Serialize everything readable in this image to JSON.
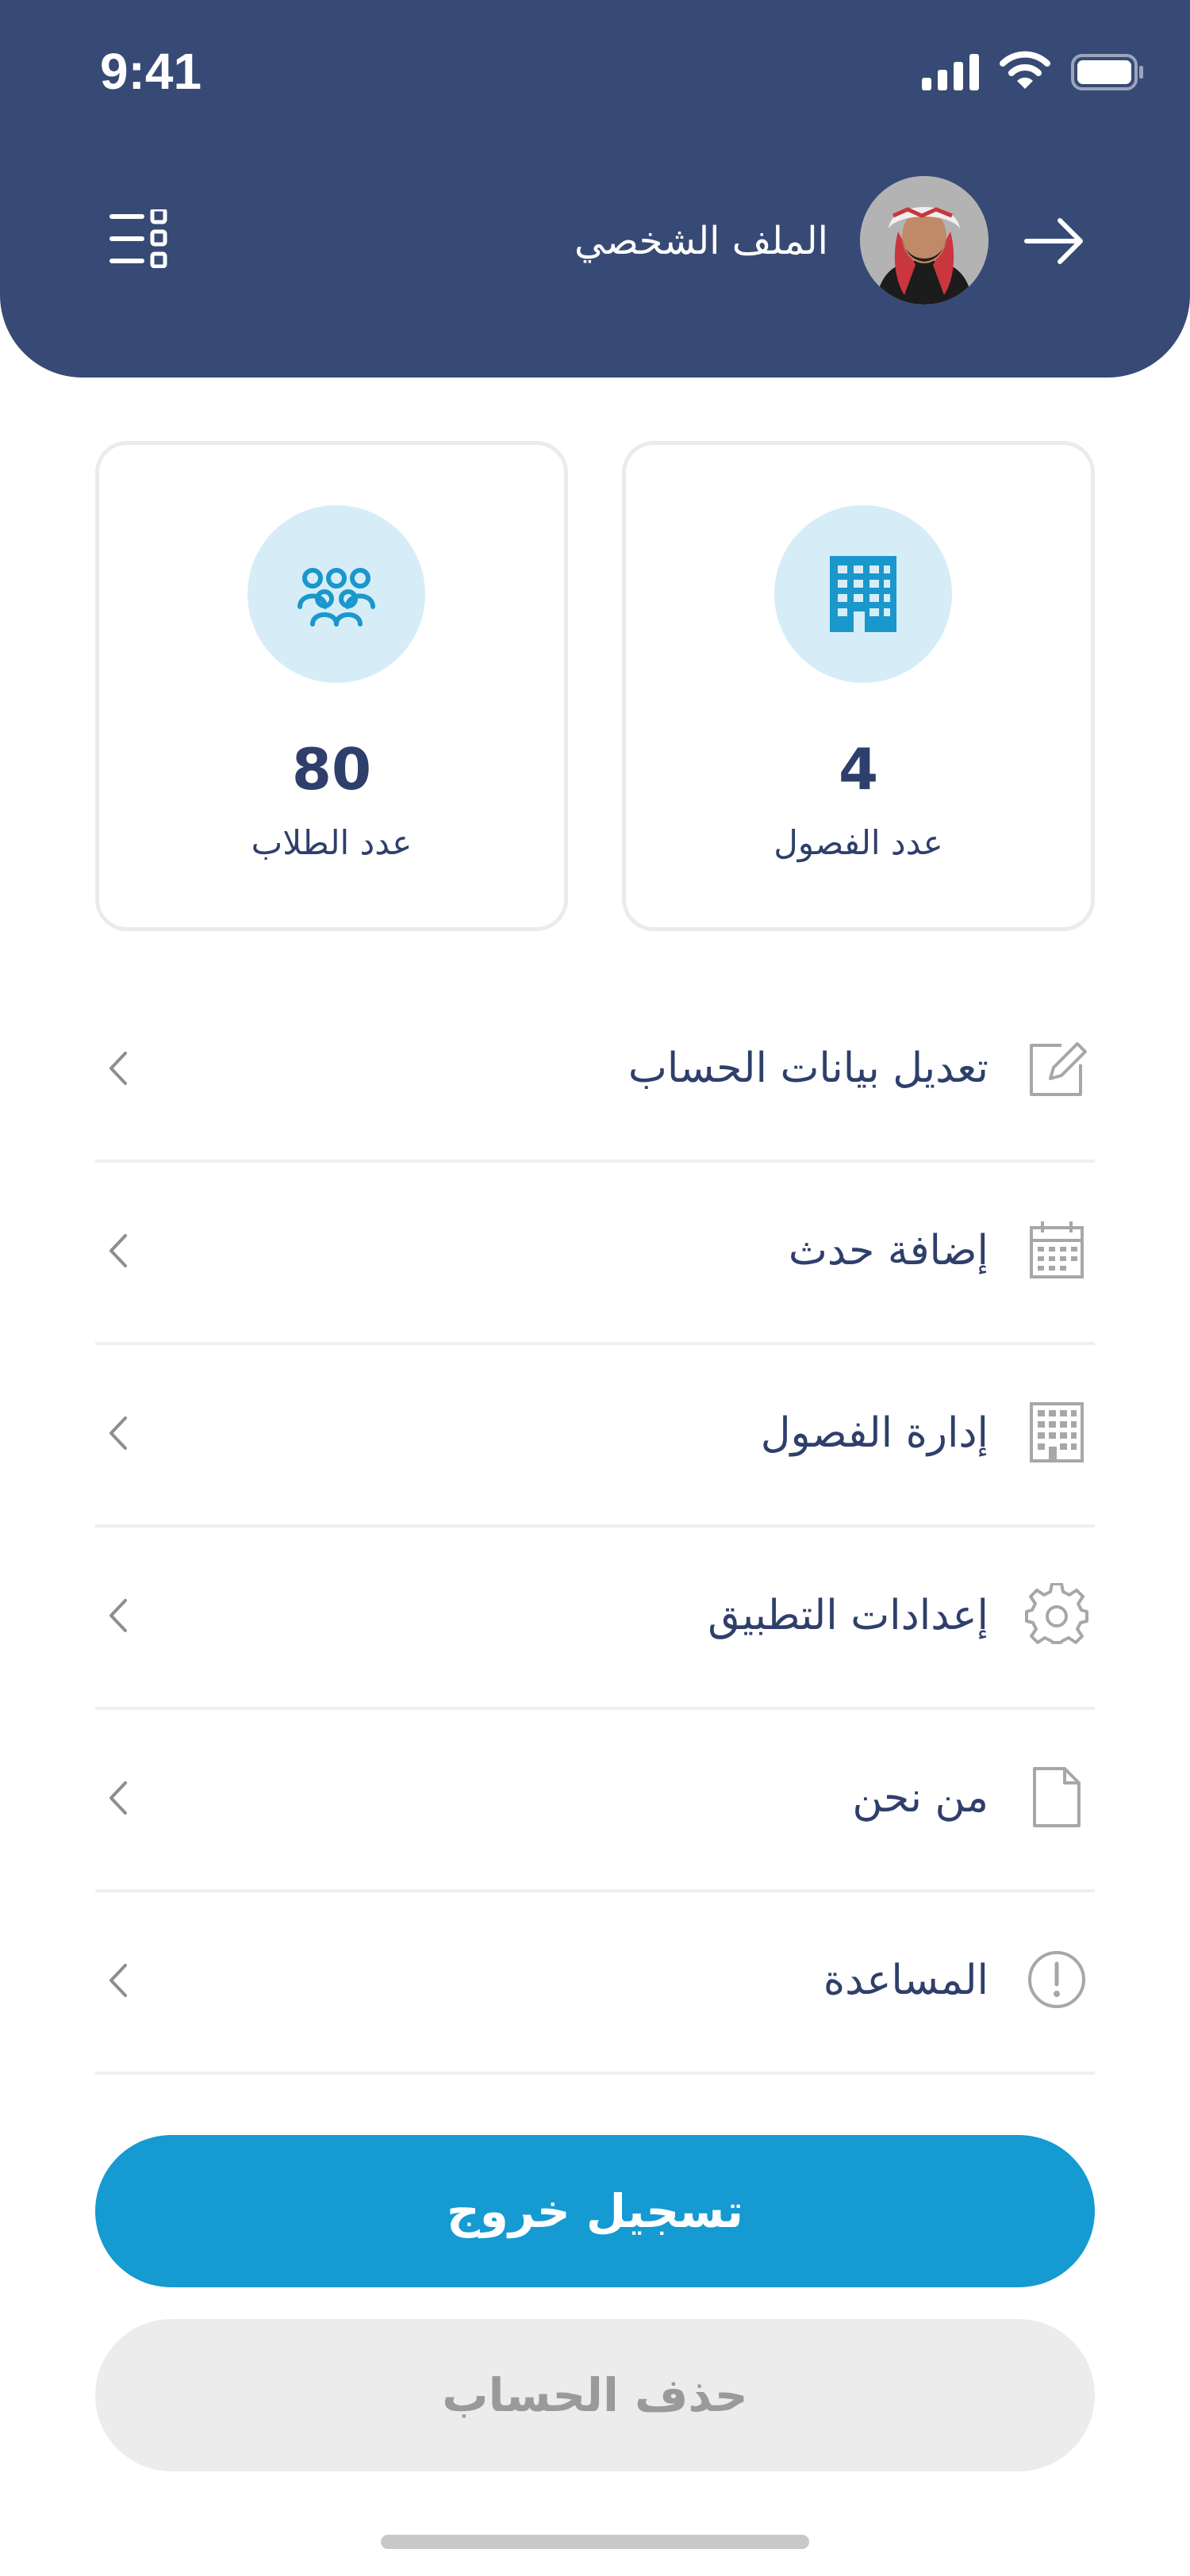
{
  "status_bar": {
    "time": "9:41"
  },
  "header": {
    "title": "الملف الشخصي",
    "background_color": "#374a75"
  },
  "stats": [
    {
      "value": "80",
      "label": "عدد الطلاب",
      "icon": "students-group-icon"
    },
    {
      "value": "4",
      "label": "عدد الفصول",
      "icon": "building-icon"
    }
  ],
  "menu": {
    "items": [
      {
        "label": "تعديل بيانات الحساب",
        "icon": "edit-icon"
      },
      {
        "label": "إضافة حدث",
        "icon": "calendar-icon"
      },
      {
        "label": "إدارة الفصول",
        "icon": "building-icon"
      },
      {
        "label": "إعدادات التطبيق",
        "icon": "gear-icon"
      },
      {
        "label": "من نحن",
        "icon": "document-icon"
      },
      {
        "label": "المساعدة",
        "icon": "info-icon"
      }
    ]
  },
  "actions": {
    "logout_label": "تسجيل خروج",
    "delete_label": "حذف الحساب",
    "logout_color": "#159ad1"
  }
}
